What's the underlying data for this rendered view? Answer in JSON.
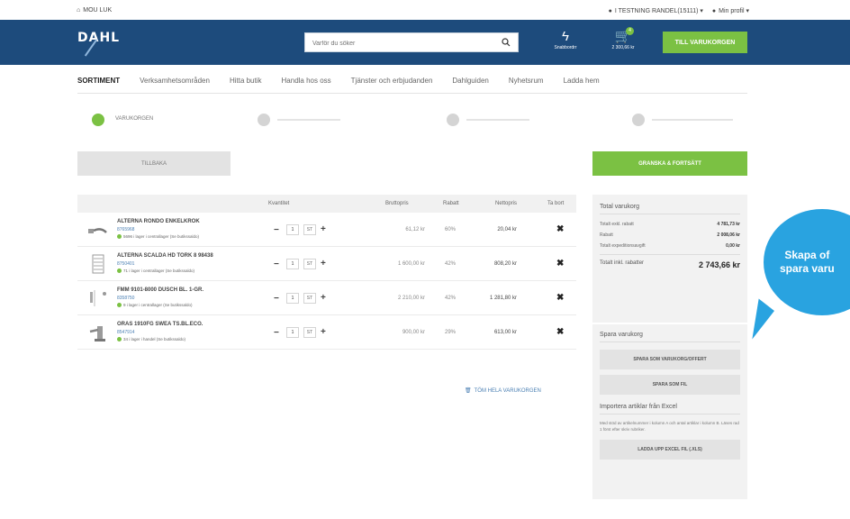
{
  "utility": {
    "home": "MOU LUK",
    "company": "I TESTNING RANDEL(15111) ▾",
    "profile": "Min profil ▾"
  },
  "header": {
    "logo": "DAHL",
    "search_placeholder": "Varför du söker",
    "quick_order_label": "Snabbordrr",
    "cart_label": "2 300,66 kr",
    "cart_badge": "4",
    "to_cart_button": "TILL VARUKORGEN",
    "brand_color": "#1d4b7c",
    "accent_color": "#7bc143"
  },
  "nav": {
    "items": [
      "SORTIMENT",
      "Verksamhetsområden",
      "Hitta butik",
      "Handla hos oss",
      "Tjänster och erbjudanden",
      "Dahlguiden",
      "Nyhetsrum",
      "Ladda hem"
    ]
  },
  "steps": {
    "first_label": "VARUKORGEN"
  },
  "actions": {
    "back": "TILLBAKA",
    "continue": "GRANSKA & FORTSÄTT"
  },
  "table": {
    "headers": {
      "quantity": "Kvantitet",
      "gross": "Bruttopris",
      "discount": "Rabatt",
      "net": "Nettopris",
      "remove": "Ta bort"
    },
    "rows": [
      {
        "name": "ALTERNA RONDO ENKELKROK",
        "article": "8765968",
        "stock": "5696 i lager i centrallager (Se butikssaldo)",
        "qty": "1",
        "unit": "ST",
        "gross": "61,12 kr",
        "discount": "60%",
        "net": "20,04 kr"
      },
      {
        "name": "ALTERNA SCALDA HD TORK 8 98438",
        "article": "8750401",
        "stock": "71 i lager i centrallager (Se butikssaldo)",
        "qty": "1",
        "unit": "ST",
        "gross": "1 600,00 kr",
        "discount": "42%",
        "net": "808,20 kr"
      },
      {
        "name": "FMM 9101-8000 DUSCH BL. 1-GR.",
        "article": "8358750",
        "stock": "9 i lager i centrallager (Se butikssaldo)",
        "qty": "1",
        "unit": "ST",
        "gross": "2 210,00 kr",
        "discount": "42%",
        "net": "1 281,80 kr"
      },
      {
        "name": "ORAS 1910FG SWEA TS.BL.ECO.",
        "article": "8547914",
        "stock": "34 i lager i handel (Se butikssaldo)",
        "qty": "1",
        "unit": "ST",
        "gross": "900,00 kr",
        "discount": "29%",
        "net": "613,00 kr"
      }
    ],
    "empty_cart": "TÖM HELA VARUKORGEN"
  },
  "summary": {
    "title": "Total varukorg",
    "rows": [
      {
        "label": "Totalt exkl. rabatt",
        "value": "4 781,73 kr"
      },
      {
        "label": "Rabatt",
        "value": "2 008,06 kr"
      },
      {
        "label": "Totalt expeditionsavgift",
        "value": "0,00 kr"
      }
    ],
    "total_label": "Totalt inkl. rabatter",
    "total_value": "2 743,66 kr"
  },
  "save": {
    "title": "Spara varukorg",
    "save_quote": "SPARA SOM VARUKORG/OFFERT",
    "save_file": "SPARA SOM FIL",
    "import_title": "Importera artiklar från Excel",
    "import_text": "Med stöd av artikelnummer i kolumn A och antal artiklar i kolumn B. Läses rad 1 först efter skriv rubriker.",
    "upload": "LADDA UPP EXCEL FIL (.XLS)"
  },
  "callout": {
    "line1": "Skapa of",
    "line2": "spara varu",
    "color": "#29a3e0"
  }
}
